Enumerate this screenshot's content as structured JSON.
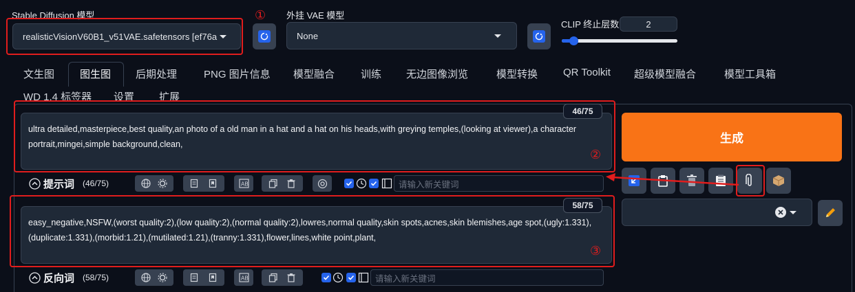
{
  "model": {
    "label": "Stable Diffusion 模型",
    "value": "realisticVisionV60B1_v51VAE.safetensors [ef76a",
    "annotation": "①"
  },
  "vae": {
    "label": "外挂 VAE 模型",
    "value": "None"
  },
  "clip": {
    "label": "CLIP 终止层数",
    "value": "2",
    "slider_fraction": 0.1
  },
  "tabs": [
    "文生图",
    "图生图",
    "后期处理",
    "PNG 图片信息",
    "模型融合",
    "训练",
    "无边图像浏览",
    "模型转换",
    "QR Toolkit",
    "超级模型融合",
    "模型工具箱",
    "WD 1.4 标签器",
    "设置",
    "扩展"
  ],
  "active_tab": "图生图",
  "prompt": {
    "text": "ultra detailed,masterpiece,best quality,an photo of a old man in a hat and a hat on his heads,with greying temples,(looking at viewer),a character portrait,mingei,simple background,clean,",
    "counter": "46/75",
    "annotation": "②",
    "toolbar_title": "提示词",
    "toolbar_count": "(46/75)",
    "keyword_placeholder": "请输入新关键词"
  },
  "negative": {
    "text": "easy_negative,NSFW,(worst quality:2),(low quality:2),(normal quality:2),lowres,normal quality,skin spots,acnes,skin blemishes,age spot,(ugly:1.331),(duplicate:1.331),(morbid:1.21),(mutilated:1.21),(tranny:1.331),flower,lines,white point,plant,",
    "counter": "58/75",
    "annotation": "③",
    "toolbar_title": "反向词",
    "toolbar_count": "(58/75)",
    "keyword_placeholder": "请输入新关键词"
  },
  "generate": {
    "label": "生成"
  },
  "colors": {
    "background": "#0b0f19",
    "accent_orange": "#f97316",
    "annotation_red": "#e11d1d",
    "checkbox_blue": "#2563eb"
  }
}
